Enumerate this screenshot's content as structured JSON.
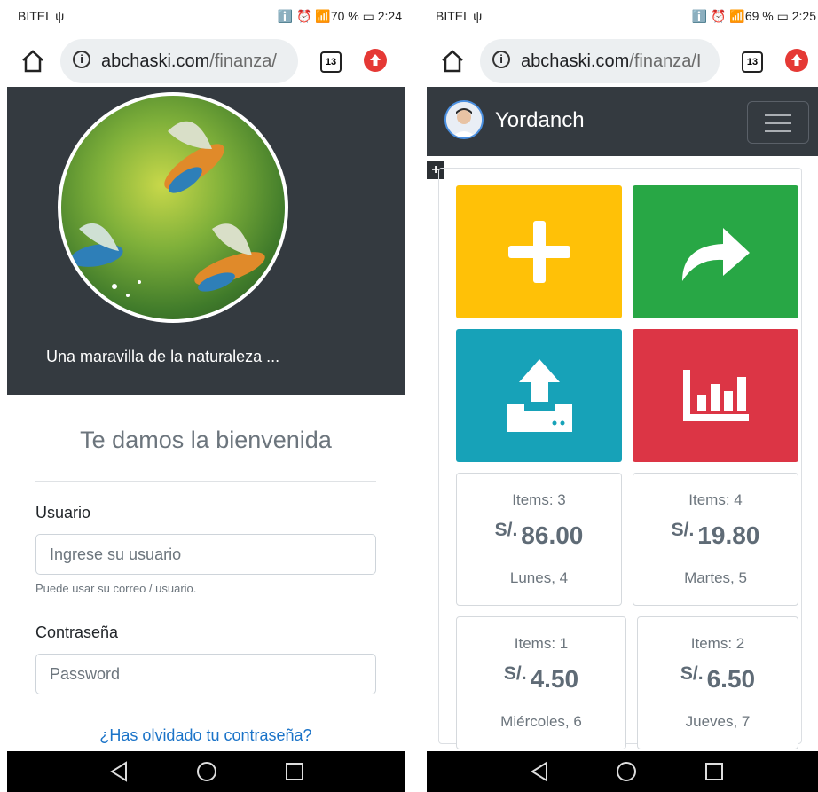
{
  "left": {
    "status": {
      "carrier": "BITEL ψ",
      "right": "ℹ️ ⏰ 📶70 % ▭ 2:24"
    },
    "url": {
      "host": "abchaski.com",
      "path": "/finanza/"
    },
    "tab_count": "13",
    "hero": {
      "caption": "Una maravilla de la naturaleza ..."
    },
    "login": {
      "title": "Te damos la bienvenida",
      "user_label": "Usuario",
      "user_placeholder": "Ingrese su usuario",
      "user_help": "Puede usar su correo / usuario.",
      "pass_label": "Contraseña",
      "pass_placeholder": "Password",
      "forgot": "¿Has olvidado tu contraseña?"
    }
  },
  "right": {
    "status": {
      "carrier": "BITEL ψ",
      "right": "ℹ️ ⏰ 📶69 % ▭ 2:25"
    },
    "url": {
      "host": "abchaski.com",
      "path": "/finanza/I"
    },
    "tab_count": "13",
    "user": {
      "name": "Yordanch"
    },
    "plus_tag": "+",
    "tiles": [
      {
        "name": "add",
        "color": "#ffc107",
        "icon": "plus-icon"
      },
      {
        "name": "share",
        "color": "#28a745",
        "icon": "share-arrow-icon"
      },
      {
        "name": "upload",
        "color": "#17a2b8",
        "icon": "upload-icon"
      },
      {
        "name": "stats",
        "color": "#dc3545",
        "icon": "bar-chart-icon"
      }
    ],
    "days": [
      {
        "items": "Items: 3",
        "currency": "S/.",
        "amount": "86.00",
        "date": "Lunes, 4"
      },
      {
        "items": "Items: 4",
        "currency": "S/.",
        "amount": "19.80",
        "date": "Martes, 5"
      },
      {
        "items": "Items: 1",
        "currency": "S/.",
        "amount": "4.50",
        "date": "Miércoles, 6"
      },
      {
        "items": "Items: 2",
        "currency": "S/.",
        "amount": "6.50",
        "date": "Jueves, 7"
      }
    ]
  }
}
